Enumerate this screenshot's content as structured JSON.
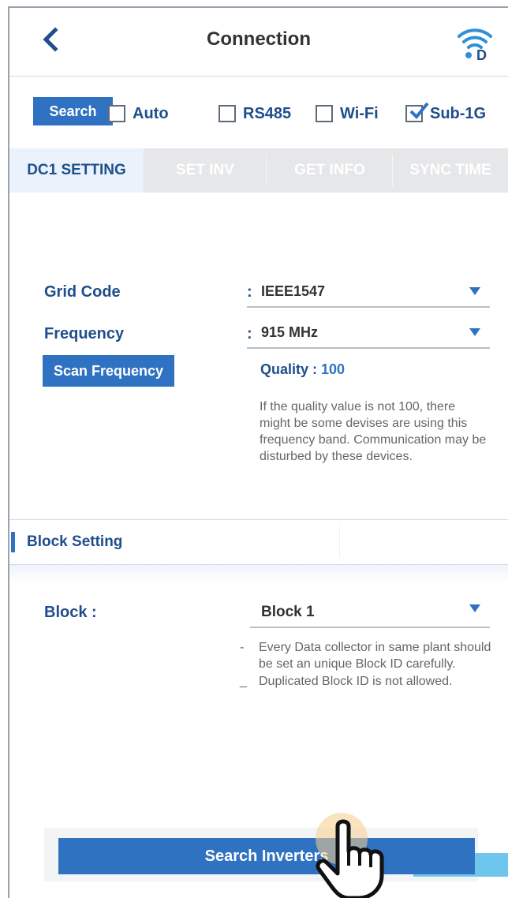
{
  "header": {
    "title": "Connection",
    "back_icon": "chevron-left-icon",
    "status_icon": "wifi-d-icon"
  },
  "search_row": {
    "search_label": "Search",
    "options": [
      {
        "label": "Auto",
        "checked": false
      },
      {
        "label": "RS485",
        "checked": false
      },
      {
        "label": "Wi-Fi",
        "checked": false
      },
      {
        "label": "Sub-1G",
        "checked": true
      }
    ]
  },
  "tabs": [
    {
      "label": "DC1 SETTING",
      "active": true
    },
    {
      "label": "SET INV",
      "active": false
    },
    {
      "label": "GET INFO",
      "active": false
    },
    {
      "label": "SYNC TIME",
      "active": false
    }
  ],
  "grid_code": {
    "label": "Grid Code",
    "colon": ":",
    "value": "IEEE1547"
  },
  "frequency": {
    "label": "Frequency",
    "colon": ":",
    "value": "915 MHz"
  },
  "scan": {
    "button_label": "Scan Frequency",
    "quality_label": "Quality : ",
    "quality_value": "100",
    "note": "If the quality value is not 100, there might be some devises are using this frequency band. Communication may be disturbed by these devices."
  },
  "block_setting": {
    "section_title": "Block Setting",
    "label": "Block :",
    "value": "Block 1",
    "notes": [
      {
        "dash": "-",
        "text": "Every Data collector in same plant should be set an unique Block ID carefully."
      },
      {
        "dash": "_",
        "text": "Duplicated Block ID is not allowed."
      }
    ]
  },
  "footer": {
    "button_label": "Search Inverters"
  },
  "colors": {
    "accent": "#2f72c2",
    "text_blue": "#1f4e8c",
    "tab_inactive_bg": "#e6e7e9"
  }
}
